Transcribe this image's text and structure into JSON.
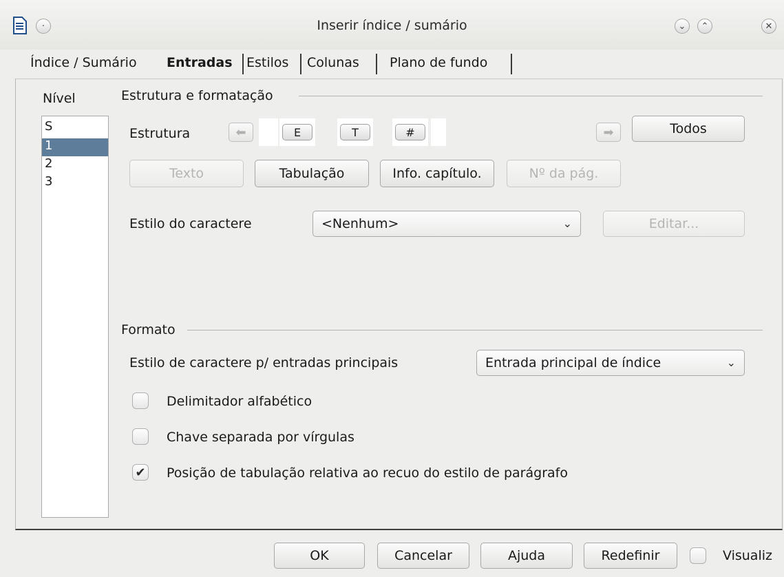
{
  "window": {
    "title": "Inserir índice / sumário",
    "doc_icon": "writer-document-icon"
  },
  "tabs": [
    {
      "label": "Índice / Sumário",
      "active": false
    },
    {
      "label": "Entradas",
      "active": true
    },
    {
      "label": "Estilos",
      "active": false
    },
    {
      "label": "Colunas",
      "active": false
    },
    {
      "label": "Plano de fundo",
      "active": false
    }
  ],
  "level": {
    "label": "Nível",
    "items": [
      "S",
      "1",
      "2",
      "3"
    ],
    "selected": "1"
  },
  "structure_section": {
    "title": "Estrutura e formatação",
    "structure_label": "Estrutura",
    "tokens": [
      "E",
      "T",
      "#"
    ],
    "all_button": "Todos",
    "insert_buttons": {
      "text": "Texto",
      "tab": "Tabulação",
      "chapter_info": "Info. capítulo.",
      "page_no": "Nº da pág."
    },
    "char_style_label": "Estilo do caractere",
    "char_style_value": "<Nenhum>",
    "edit_button": "Editar..."
  },
  "format_section": {
    "title": "Formato",
    "main_entry_style_label": "Estilo de caractere p/ entradas principais",
    "main_entry_style_value": "Entrada principal de índice",
    "options": [
      {
        "label": "Delimitador alfabético",
        "checked": false
      },
      {
        "label": "Chave separada por vírgulas",
        "checked": false
      },
      {
        "label": "Posição de tabulação relativa ao recuo do estilo de parágrafo",
        "checked": true
      }
    ]
  },
  "footer": {
    "ok": "OK",
    "cancel": "Cancelar",
    "help": "Ajuda",
    "reset": "Redefinir",
    "preview": "Visualiz",
    "preview_checked": false
  }
}
